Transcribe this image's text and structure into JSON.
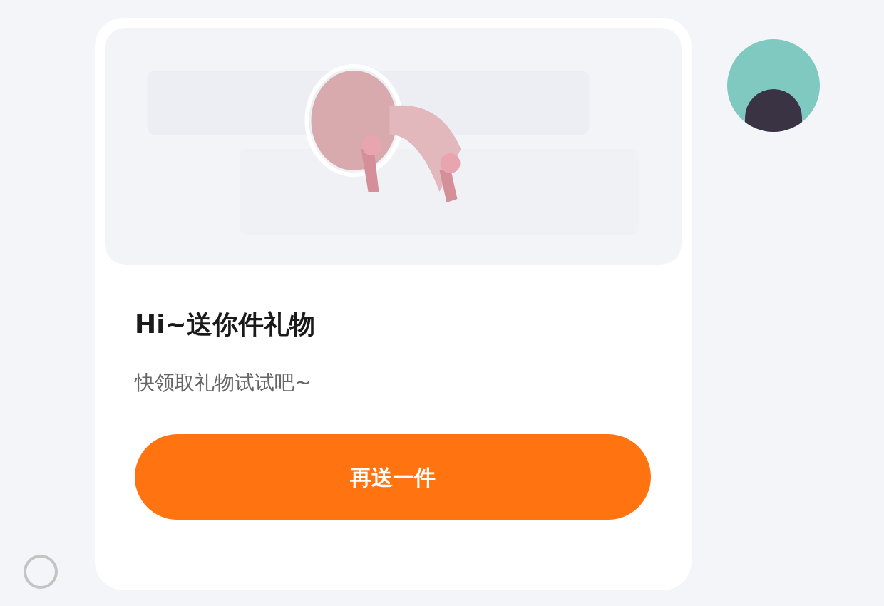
{
  "message": {
    "title": "Hi~送你件礼物",
    "subtitle": "快领取礼物试试吧~",
    "button": "再送一件"
  },
  "select": {
    "selected": false
  }
}
